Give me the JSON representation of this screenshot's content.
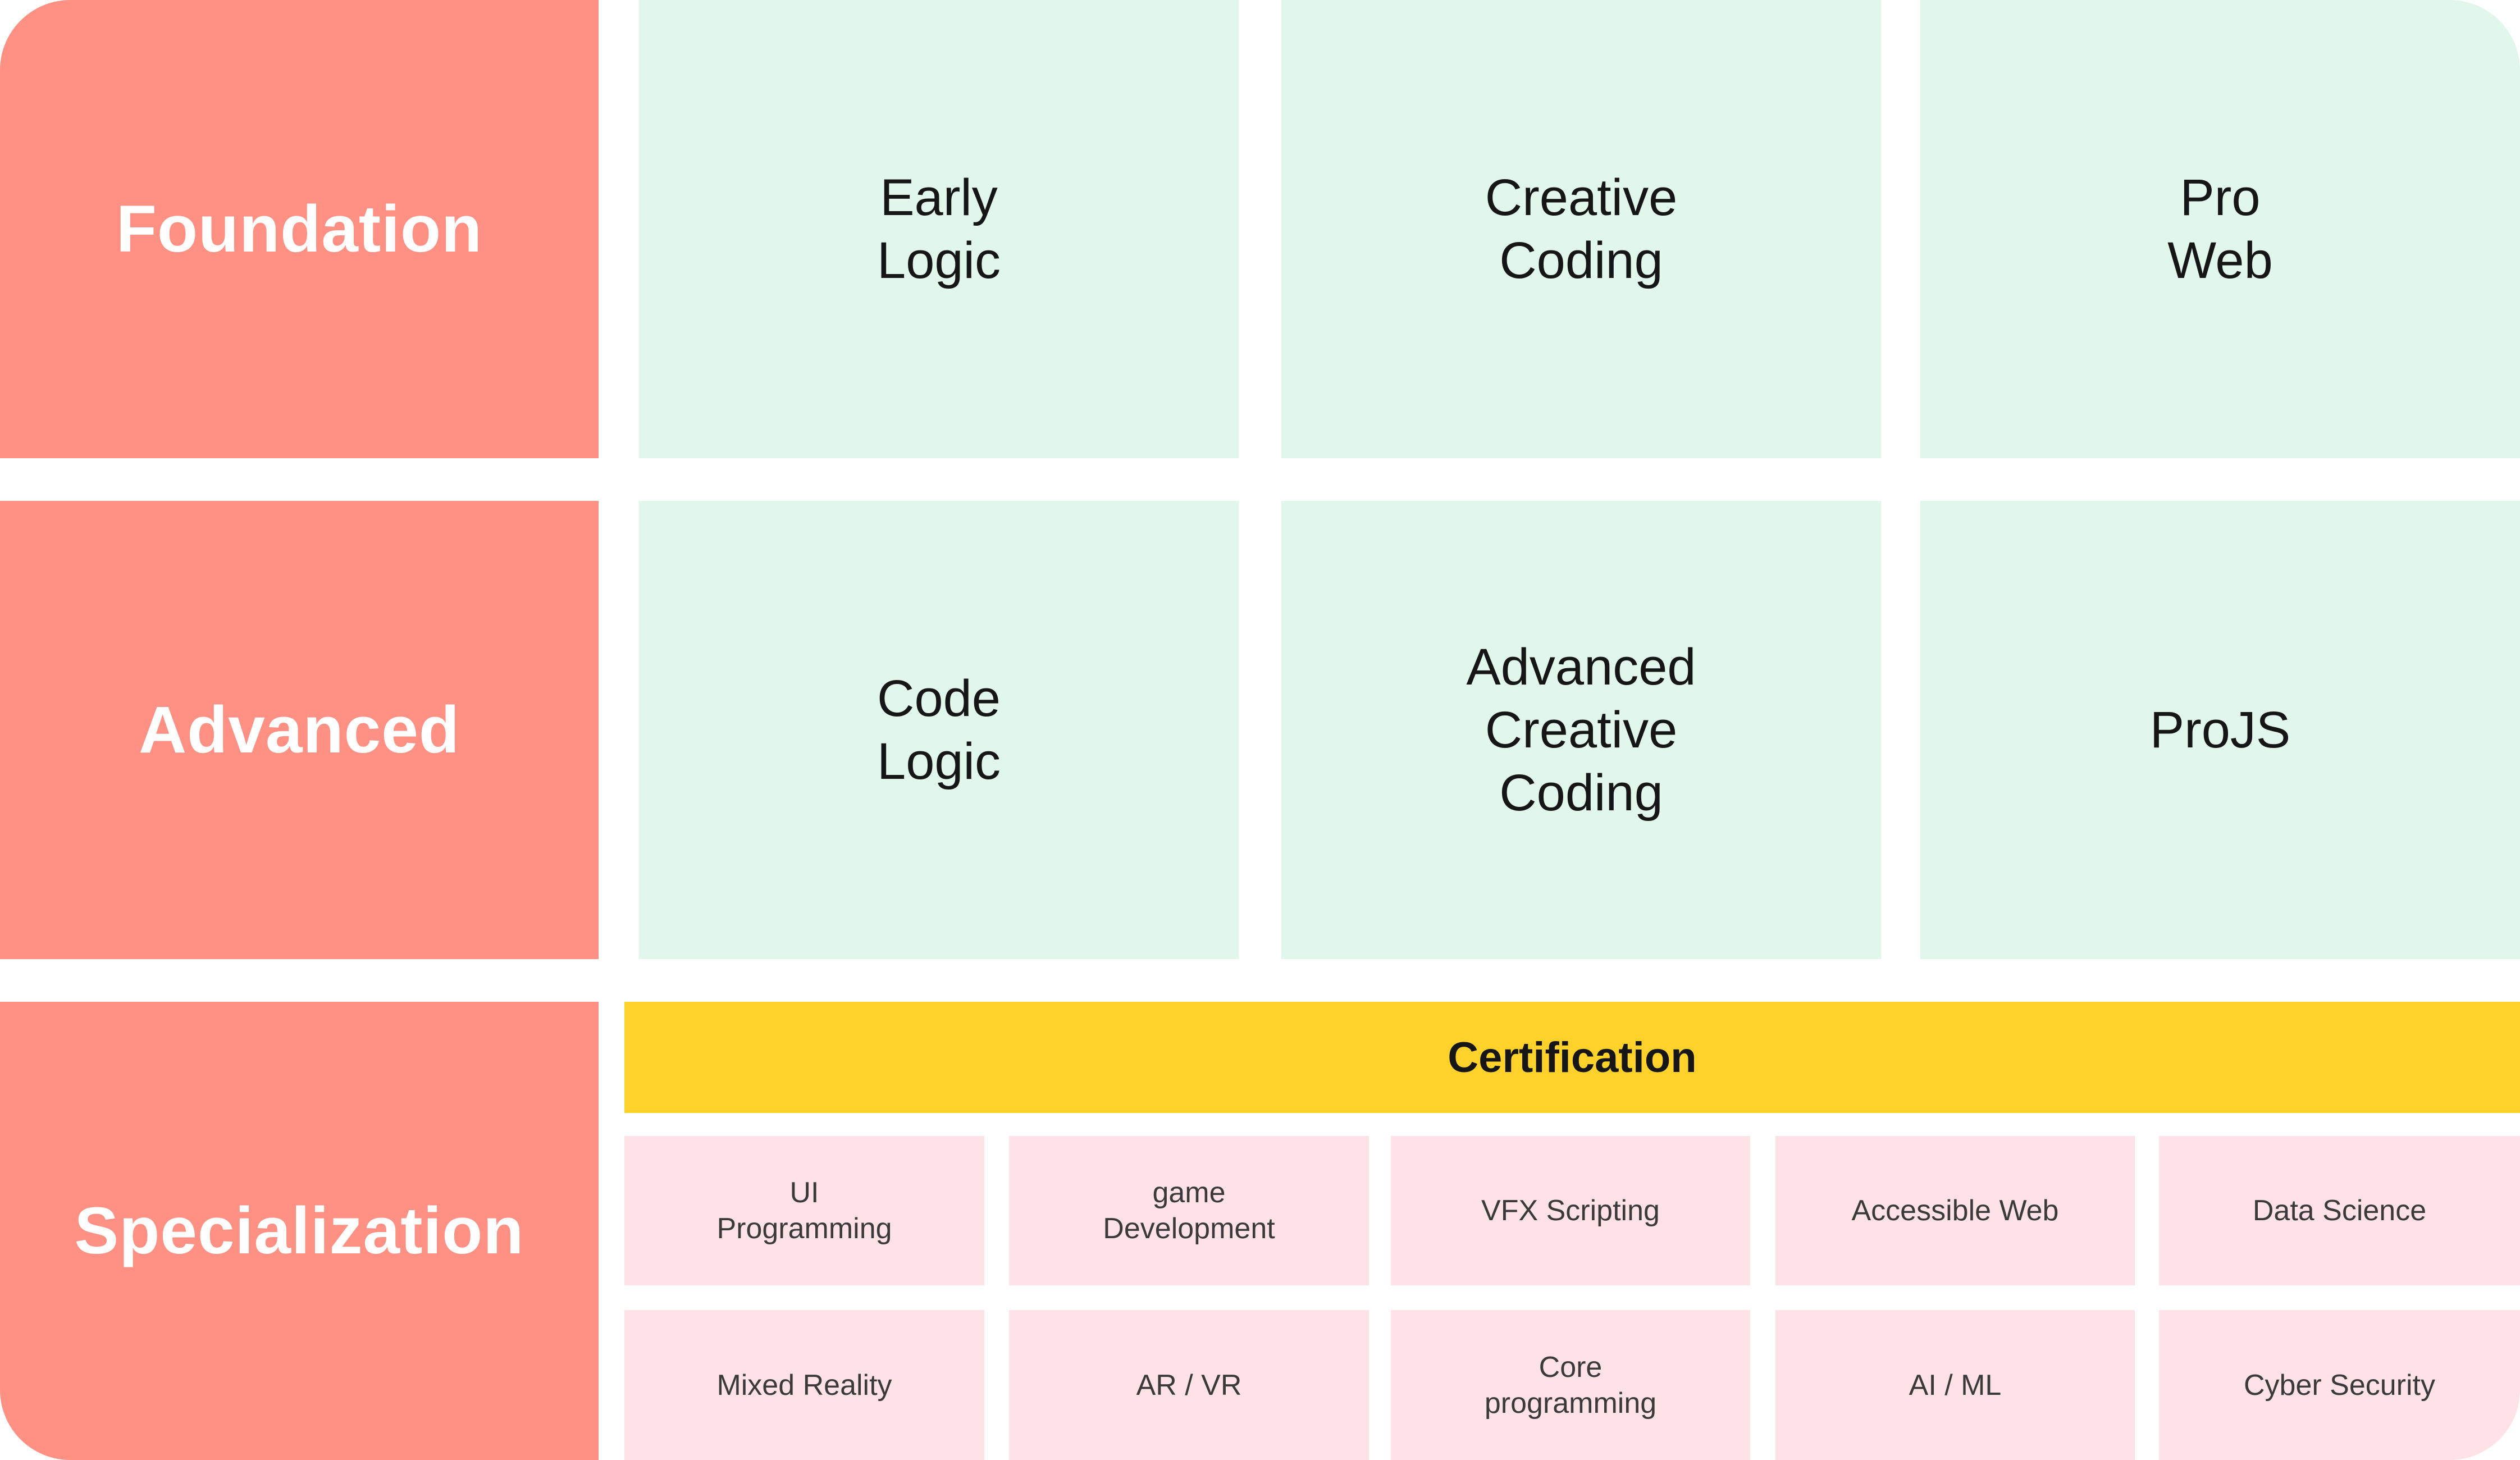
{
  "colors": {
    "level_bg": "#FF9184",
    "course_bg": "#E2F7EB",
    "certification_bg": "#FED22A",
    "specialization_bg": "#FFE2E5",
    "text_dark": "#161616",
    "text_light": "#ffffff"
  },
  "levels": [
    {
      "label": "Foundation"
    },
    {
      "label": "Advanced"
    },
    {
      "label": "Specialization"
    }
  ],
  "courses": [
    [
      {
        "label": "Early\nLogic"
      },
      {
        "label": "Creative\nCoding"
      },
      {
        "label": "Pro\nWeb"
      }
    ],
    [
      {
        "label": "Code\nLogic"
      },
      {
        "label": "Advanced\nCreative\nCoding"
      },
      {
        "label": "ProJS"
      }
    ]
  ],
  "certification": {
    "label": "Certification"
  },
  "specializations": [
    [
      {
        "label": "UI\nProgramming"
      },
      {
        "label": "game\nDevelopment"
      },
      {
        "label": "VFX Scripting"
      },
      {
        "label": "Accessible Web"
      },
      {
        "label": "Data Science"
      }
    ],
    [
      {
        "label": "Mixed Reality"
      },
      {
        "label": "AR / VR"
      },
      {
        "label": "Core\nprogramming"
      },
      {
        "label": "AI / ML"
      },
      {
        "label": "Cyber Security"
      }
    ]
  ]
}
